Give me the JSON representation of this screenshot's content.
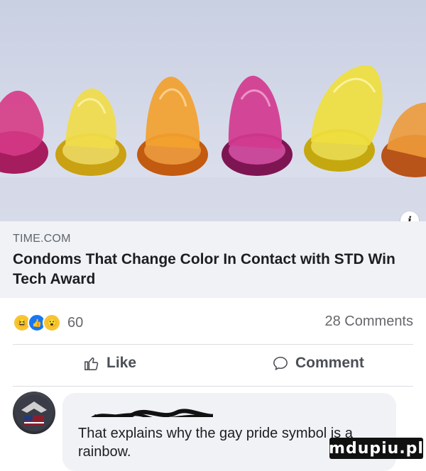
{
  "post_image": {
    "description_icon": "condom-photo",
    "colors": [
      "#d9b72a",
      "#d87a1c",
      "#b3246d",
      "#e2c41f"
    ]
  },
  "link_preview": {
    "domain": "TIME.COM",
    "title": "Condoms That Change Color In Contact with STD Win Tech Award",
    "info_icon": "i"
  },
  "reactions": {
    "icons": [
      "haha-icon",
      "like-icon",
      "wow-icon"
    ],
    "count": "60",
    "comments": "28 Comments"
  },
  "actions": {
    "like_label": "Like",
    "comment_label": "Comment"
  },
  "comment": {
    "text": "That explains why the gay pride symbol is a rainbow."
  },
  "watermark": {
    "text": "mdupiu.pl"
  }
}
